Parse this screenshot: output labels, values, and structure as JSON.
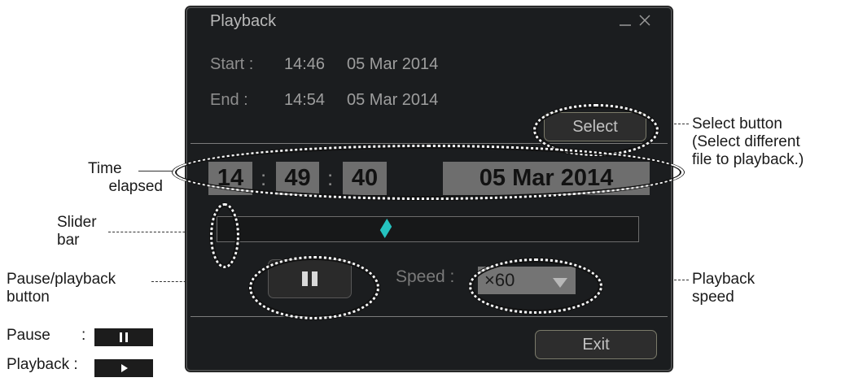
{
  "window": {
    "title": "Playback",
    "minimize_icon": "minimize-icon",
    "close_icon": "close-icon"
  },
  "range": {
    "start_label": "Start :",
    "start_time": "14:46",
    "start_date": "05 Mar 2014",
    "end_label": "End :",
    "end_time": "14:54",
    "end_date": "05 Mar 2014",
    "select_label": "Select"
  },
  "clock": {
    "hours": "14",
    "minutes": "49",
    "seconds": "40",
    "sep1": ":",
    "sep2": ":",
    "date": "05 Mar 2014"
  },
  "slider": {
    "position_fraction": 0.4
  },
  "controls": {
    "pause_icon": "pause-icon",
    "speed_label": "Speed :",
    "speed_value": "×60",
    "dropdown_icon": "chevron-down-icon",
    "exit_label": "Exit"
  },
  "callouts": {
    "time_elapsed_line1": "Time",
    "time_elapsed_line2": "elapsed",
    "slider_line1": "Slider",
    "slider_line2": "bar",
    "pause_line1": "Pause/playback",
    "pause_line2": "button",
    "pause_legend": "Pause",
    "pause_legend_colon": ":",
    "playback_legend": "Playback :",
    "select_line1": "Select button",
    "select_line2": "(Select different",
    "select_line3": "file to playback.)",
    "speed_line1": "Playback",
    "speed_line2": "speed"
  },
  "colors": {
    "window_bg": "#1b1d1f",
    "slider_thumb": "#25c3c0",
    "time_box": "#6e6e6e"
  }
}
